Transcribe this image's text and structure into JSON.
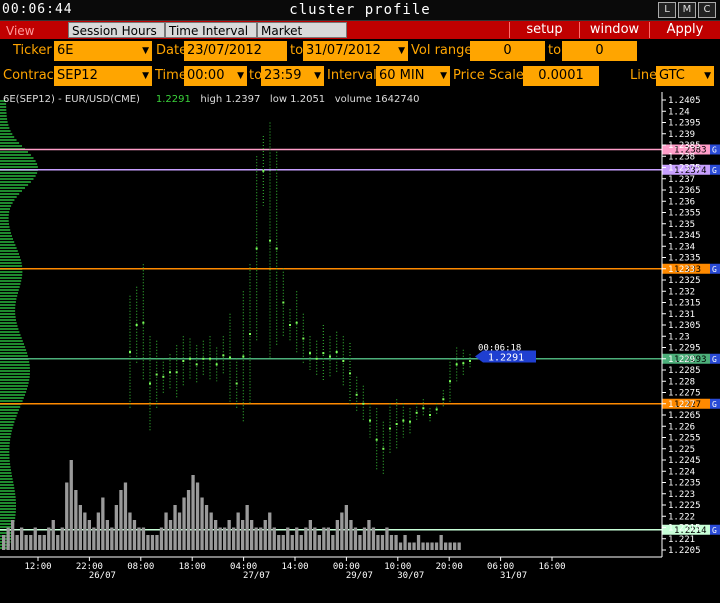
{
  "window": {
    "clock": "00:06:44",
    "title": "cluster profile",
    "buttons": [
      "L",
      "M",
      "C"
    ]
  },
  "menu": {
    "tabs": [
      {
        "label": "View DOM",
        "active": true
      },
      {
        "label": "Session Hours",
        "active": false
      },
      {
        "label": "Time Interval",
        "active": false
      },
      {
        "label": "Market Watch",
        "active": false
      }
    ],
    "setup": "setup",
    "window": "window",
    "apply": "Apply"
  },
  "controls": {
    "ticker_label": "Ticker",
    "ticker": "6E",
    "date_label": "Date",
    "date_from": "23/07/2012",
    "to1": "to",
    "date_to": "31/07/2012",
    "vol_range_label": "Vol range",
    "vol_min": "0",
    "to2": "to",
    "vol_max": "0",
    "contract_label": "Contract",
    "contract": "SEP12",
    "time_label": "Time",
    "time_from": "00:00",
    "to3": "to",
    "time_to": "23:59",
    "interval_label": "Interval",
    "interval": "60 MIN",
    "price_scale_label": "Price Scale",
    "price_scale": "0.0001",
    "line_label": "Line",
    "line": "GTC"
  },
  "info": {
    "instrument": "6E(SEP12) - EUR/USD(CME)",
    "last": "1.2291",
    "high": "high 1.2397",
    "low": "low 1.2051",
    "volume": "volume 1642740"
  },
  "colors": {
    "accent": "#ffa500",
    "menubar": "#c00000",
    "price": "#3ad13a",
    "pink_line": "#ff9ec9",
    "violet_line": "#c8a0ff",
    "orange_line": "#ff8a00",
    "green_line": "#4caf7a",
    "mint_line": "#c8ffd8",
    "current_box": "#1f3fd1"
  },
  "chart_data": {
    "type": "candlestick-volume",
    "y_ticks": [
      "1.2405",
      "1.24",
      "1.2395",
      "1.239",
      "1.2385",
      "1.238",
      "1.2375",
      "1.237",
      "1.2365",
      "1.236",
      "1.2355",
      "1.235",
      "1.2345",
      "1.234",
      "1.2335",
      "1.233",
      "1.2325",
      "1.232",
      "1.2315",
      "1.231",
      "1.2305",
      "1.23",
      "1.2295",
      "1.229",
      "1.2285",
      "1.228",
      "1.2275",
      "1.227",
      "1.2265",
      "1.226",
      "1.2255",
      "1.225",
      "1.2245",
      "1.224",
      "1.2235",
      "1.223",
      "1.2225",
      "1.222",
      "1.2215",
      "1.221",
      "1.2205"
    ],
    "ylim": [
      1.2205,
      1.2405
    ],
    "x_ticks": [
      {
        "label": "12:00",
        "date": ""
      },
      {
        "label": "22:00",
        "date": "26/07"
      },
      {
        "label": "08:00",
        "date": ""
      },
      {
        "label": "18:00",
        "date": ""
      },
      {
        "label": "04:00",
        "date": "27/07"
      },
      {
        "label": "14:00",
        "date": ""
      },
      {
        "label": "00:00",
        "date": "29/07"
      },
      {
        "label": "10:00",
        "date": "30/07"
      },
      {
        "label": "20:00",
        "date": ""
      },
      {
        "label": "06:00",
        "date": "31/07"
      },
      {
        "label": "16:00",
        "date": ""
      }
    ],
    "levels": [
      {
        "price": 1.2383,
        "label": "1.2383",
        "color": "#ff9ec9"
      },
      {
        "price": 1.2374,
        "label": "1.2374",
        "color": "#c8a0ff"
      },
      {
        "price": 1.233,
        "label": "1.233",
        "color": "#ff8a00"
      },
      {
        "price": 1.229,
        "label": "1.2293",
        "color": "#4caf7a"
      },
      {
        "price": 1.227,
        "label": "1.227",
        "color": "#ff8a00"
      },
      {
        "price": 1.2214,
        "label": "1.2214",
        "color": "#c8ffd8"
      }
    ],
    "level_tag": "G",
    "current_time": "00:06:18",
    "current_price": "1.2291",
    "bars": [
      [
        1.2268,
        1.2318
      ],
      [
        1.2288,
        1.2322
      ],
      [
        1.228,
        1.2332
      ],
      [
        1.2258,
        1.23
      ],
      [
        1.2268,
        1.2298
      ],
      [
        1.2274,
        1.229
      ],
      [
        1.2276,
        1.2292
      ],
      [
        1.2272,
        1.2296
      ],
      [
        1.2278,
        1.23
      ],
      [
        1.2281,
        1.2299
      ],
      [
        1.2279,
        1.2296
      ],
      [
        1.2282,
        1.2298
      ],
      [
        1.228,
        1.23
      ],
      [
        1.228,
        1.2295
      ],
      [
        1.2283,
        1.23
      ],
      [
        1.2271,
        1.231
      ],
      [
        1.2268,
        1.229
      ],
      [
        1.2262,
        1.232
      ],
      [
        1.227,
        1.2332
      ],
      [
        1.2298,
        1.238
      ],
      [
        1.2358,
        1.2389
      ],
      [
        1.229,
        1.2395
      ],
      [
        1.2296,
        1.2382
      ],
      [
        1.23,
        1.233
      ],
      [
        1.2298,
        1.2312
      ],
      [
        1.2292,
        1.232
      ],
      [
        1.2288,
        1.231
      ],
      [
        1.2285,
        1.23
      ],
      [
        1.2282,
        1.2298
      ],
      [
        1.228,
        1.2305
      ],
      [
        1.2282,
        1.23
      ],
      [
        1.2284,
        1.2302
      ],
      [
        1.2278,
        1.23
      ],
      [
        1.227,
        1.2297
      ],
      [
        1.2266,
        1.2282
      ],
      [
        1.2262,
        1.2278
      ],
      [
        1.2255,
        1.227
      ],
      [
        1.224,
        1.2268
      ],
      [
        1.2238,
        1.2262
      ],
      [
        1.2248,
        1.227
      ],
      [
        1.225,
        1.2272
      ],
      [
        1.2255,
        1.227
      ],
      [
        1.2256,
        1.2268
      ],
      [
        1.2262,
        1.227
      ],
      [
        1.2264,
        1.2272
      ],
      [
        1.2262,
        1.2268
      ],
      [
        1.2265,
        1.227
      ],
      [
        1.2268,
        1.2276
      ],
      [
        1.227,
        1.229
      ],
      [
        1.228,
        1.2295
      ],
      [
        1.2282,
        1.2294
      ],
      [
        1.2286,
        1.2292
      ]
    ],
    "volume_bars": [
      2,
      3,
      4,
      2,
      3,
      2,
      2,
      3,
      2,
      2,
      3,
      4,
      2,
      3,
      9,
      12,
      8,
      6,
      5,
      4,
      3,
      5,
      7,
      4,
      3,
      6,
      8,
      9,
      5,
      4,
      3,
      3,
      2,
      2,
      2,
      3,
      5,
      4,
      6,
      5,
      7,
      8,
      10,
      9,
      7,
      6,
      5,
      4,
      3,
      3,
      4,
      3,
      5,
      4,
      6,
      4,
      3,
      3,
      4,
      5,
      3,
      2,
      2,
      3,
      2,
      3,
      2,
      3,
      4,
      3,
      2,
      3,
      3,
      2,
      4,
      5,
      6,
      4,
      3,
      2,
      3,
      4,
      3,
      2,
      2,
      3,
      2,
      2,
      1,
      2,
      1,
      1,
      2,
      1,
      1,
      1,
      1,
      2,
      1,
      1,
      1,
      1
    ]
  }
}
